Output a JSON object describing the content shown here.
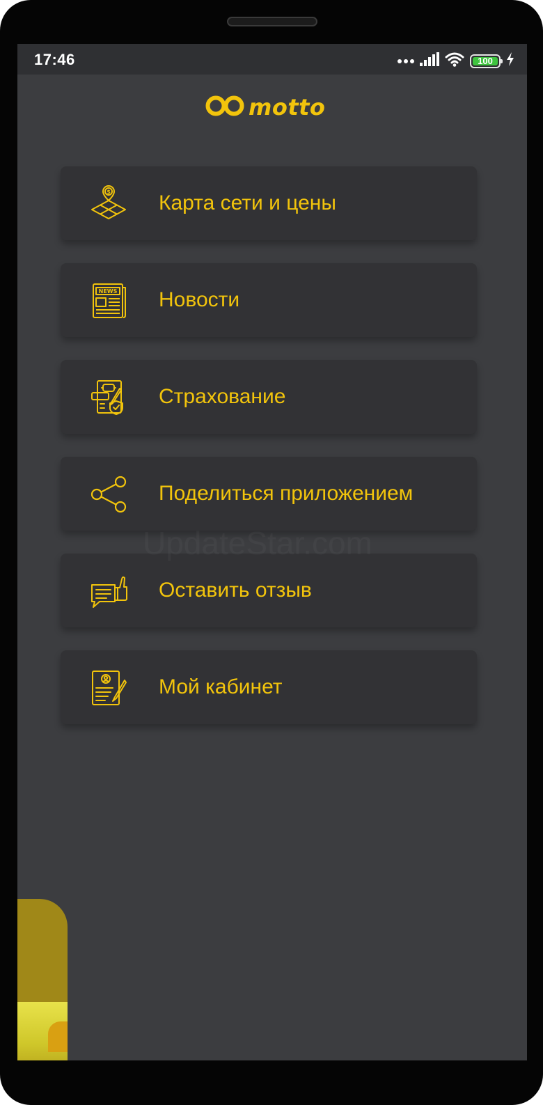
{
  "status_bar": {
    "time": "17:46",
    "battery_level": "100",
    "battery_color": "#3fc43f",
    "icons": [
      "dots-icon",
      "signal-icon",
      "wifi-icon",
      "battery-icon",
      "charging-icon"
    ]
  },
  "header": {
    "logo_text": "motto",
    "logo_icon": "infinity-logo-icon"
  },
  "menu": {
    "items": [
      {
        "label": "Карта сети и цены",
        "icon": "map-price-icon"
      },
      {
        "label": "Новости",
        "icon": "newspaper-icon"
      },
      {
        "label": "Страхование",
        "icon": "insurance-icon"
      },
      {
        "label": "Поделиться приложением",
        "icon": "share-icon"
      },
      {
        "label": "Оставить отзыв",
        "icon": "feedback-icon"
      },
      {
        "label": "Мой кабинет",
        "icon": "profile-document-icon"
      }
    ]
  },
  "watermark": "UpdateStar.com",
  "colors": {
    "accent": "#f2c40c",
    "background": "#3c3d40",
    "card": "#323235",
    "statusbar": "#2f3033"
  }
}
